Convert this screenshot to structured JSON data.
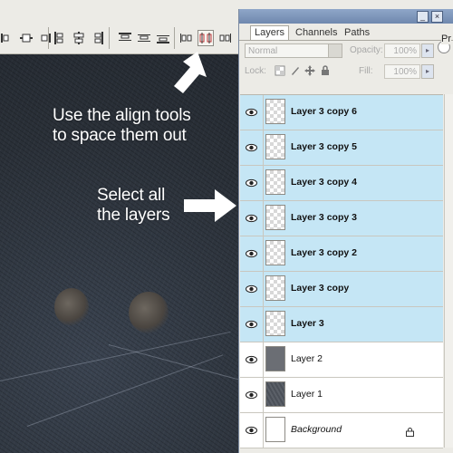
{
  "annotations": {
    "align_note": [
      "Use the align tools",
      "to space them out"
    ],
    "select_note": [
      "Select all",
      "the layers"
    ]
  },
  "options_bar": {
    "icons": [
      "align-left-edges-icon",
      "align-horizontal-centers-icon",
      "align-right-edges-icon",
      "distribute-top-icon",
      "distribute-vertical-centers-icon",
      "distribute-bottom-icon",
      "align-top-icon",
      "align-vertical-center-icon",
      "align-bottom-icon",
      "distribute-left-icon",
      "distribute-horizontal-centers-icon"
    ],
    "highlighted": "distribute-horizontal-centers-icon"
  },
  "panel": {
    "tabs": [
      "Layers",
      "Channels",
      "Paths"
    ],
    "active_tab": "Layers",
    "blend_mode": "Normal",
    "opacity_label": "Opacity:",
    "opacity_value": "100%",
    "lock_label": "Lock:",
    "fill_label": "Fill:",
    "fill_value": "100%",
    "partial_label": "Pr"
  },
  "layers": [
    {
      "name": "Layer 3 copy 6",
      "selected": true,
      "thumb": "transparent"
    },
    {
      "name": "Layer 3 copy 5",
      "selected": true,
      "thumb": "transparent"
    },
    {
      "name": "Layer 3 copy 4",
      "selected": true,
      "thumb": "transparent"
    },
    {
      "name": "Layer 3 copy 3",
      "selected": true,
      "thumb": "transparent"
    },
    {
      "name": "Layer 3 copy 2",
      "selected": true,
      "thumb": "transparent"
    },
    {
      "name": "Layer 3 copy",
      "selected": true,
      "thumb": "transparent"
    },
    {
      "name": "Layer 3",
      "selected": true,
      "thumb": "transparent"
    },
    {
      "name": "Layer 2",
      "selected": false,
      "thumb": "gray"
    },
    {
      "name": "Layer 1",
      "selected": false,
      "thumb": "texture"
    },
    {
      "name": "Background",
      "selected": false,
      "thumb": "white",
      "locked": true
    }
  ],
  "colors": {
    "selected_row": "#c5e6f5",
    "panel_bg": "#ecebe6",
    "title_bar": "#7f97bd"
  }
}
